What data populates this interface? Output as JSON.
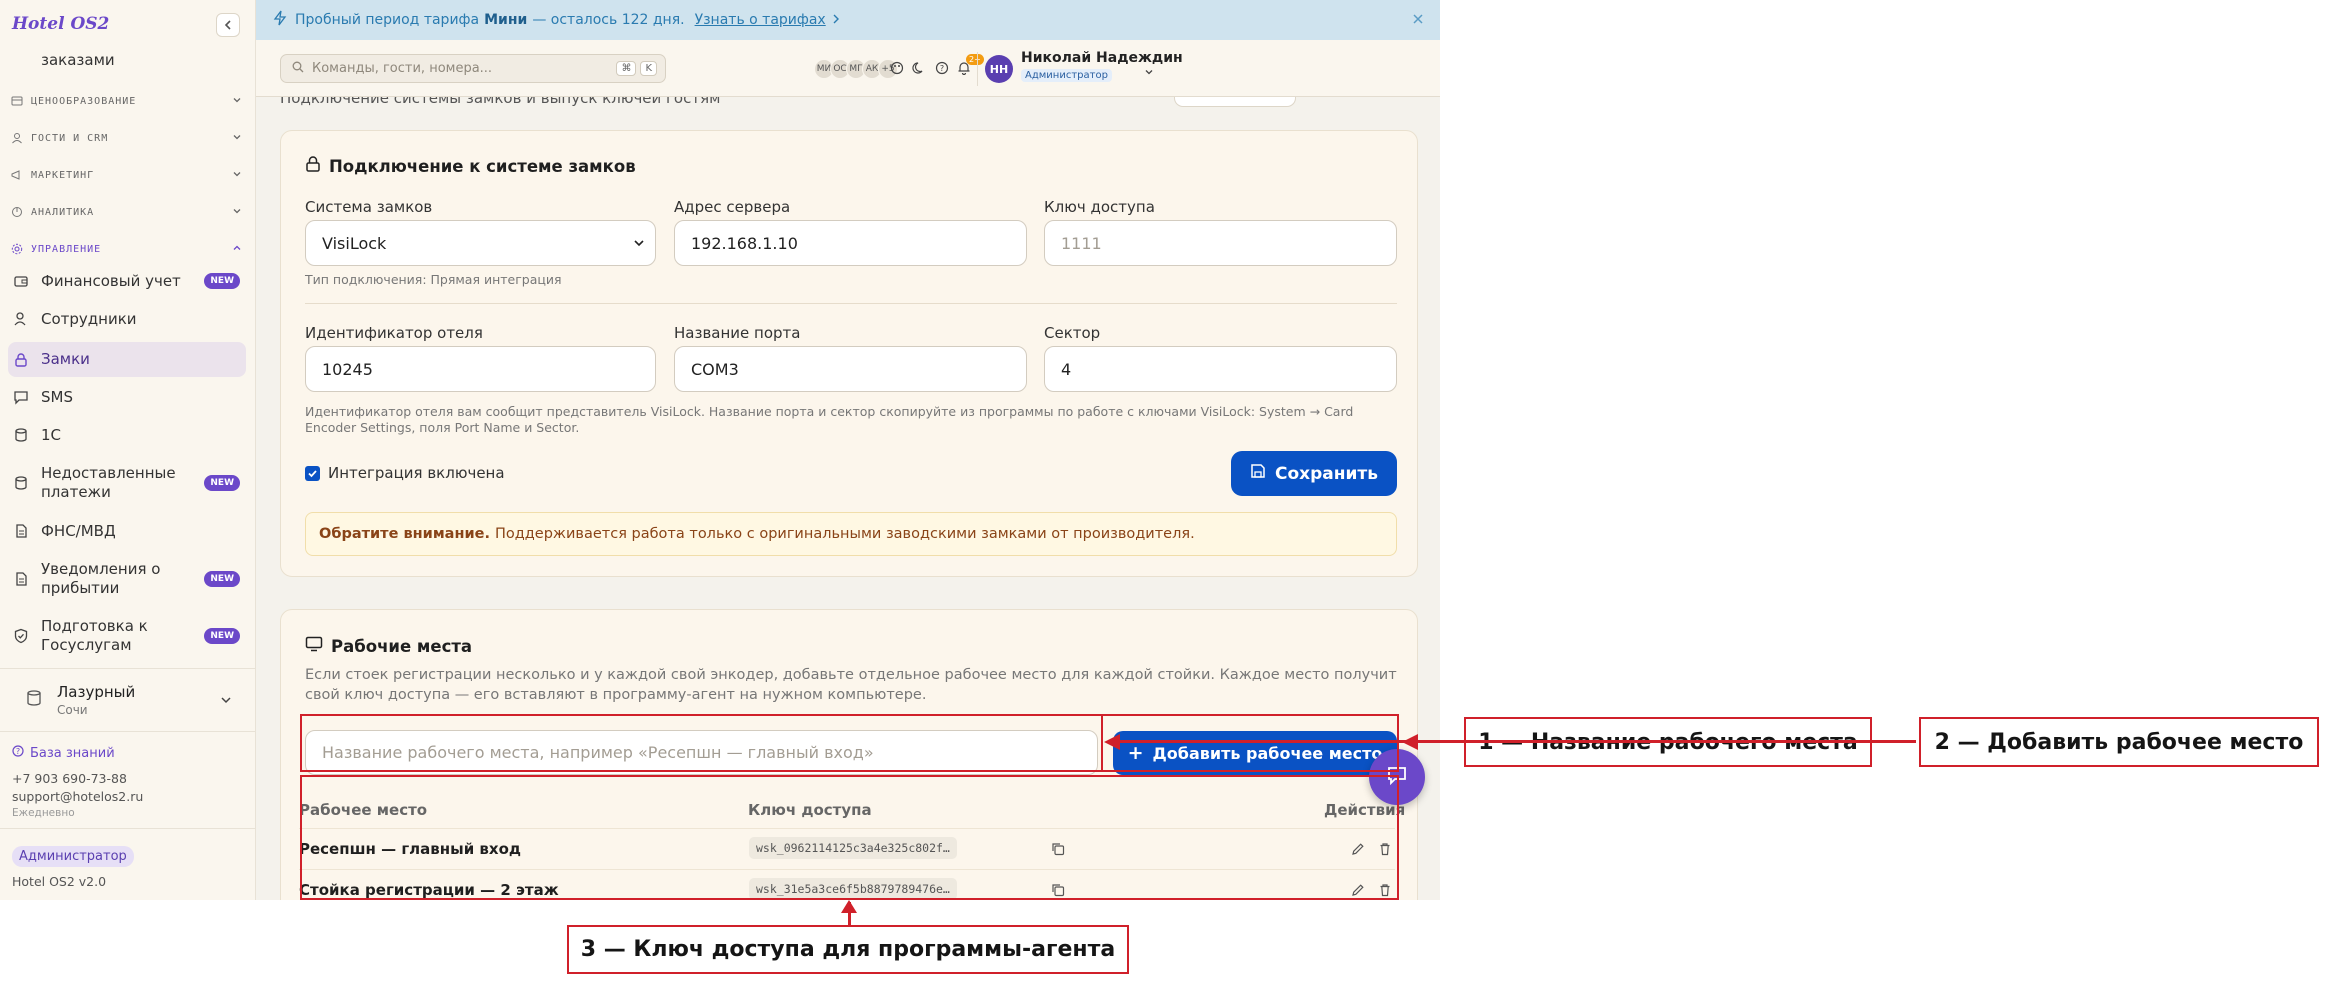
{
  "app": {
    "brand": "Hotel OS2"
  },
  "banner": {
    "text_prefix": "Пробный период тарифа",
    "plan": "Мини",
    "text_suffix": "— осталось 122 дня.",
    "link": "Узнать о тарифах"
  },
  "header": {
    "search_placeholder": "Команды, гости, номера...",
    "kbd1": "⌘",
    "kbd2": "K",
    "avatars": [
      "МИ",
      "ОС",
      "МГ",
      "АК"
    ],
    "avatars_more": "+5",
    "notif_count": "2+",
    "user_initials": "НН",
    "user_name": "Николай Надеждин",
    "user_role": "Администратор"
  },
  "sidebar": {
    "top_item": "заказами",
    "sections": [
      {
        "label": "ЦЕНООБРАЗОВАНИЕ",
        "icon": "price-tag-icon"
      },
      {
        "label": "ГОСТИ И CRM",
        "icon": "users-icon"
      },
      {
        "label": "МАРКЕТИНГ",
        "icon": "megaphone-icon"
      },
      {
        "label": "АНАЛИТИКА",
        "icon": "chart-icon"
      },
      {
        "label": "УПРАВЛЕНИЕ",
        "icon": "gear-icon"
      }
    ],
    "items": [
      {
        "label": "Финансовый учет",
        "badge": "NEW"
      },
      {
        "label": "Сотрудники",
        "badge": ""
      },
      {
        "label": "Замки",
        "badge": ""
      },
      {
        "label": "SMS",
        "badge": ""
      },
      {
        "label": "1С",
        "badge": ""
      },
      {
        "label": "Недоставленные платежи",
        "badge": "NEW"
      },
      {
        "label": "ФНС/МВД",
        "badge": ""
      },
      {
        "label": "Уведомления о прибытии",
        "badge": "NEW"
      },
      {
        "label": "Подготовка к Госуслугам",
        "badge": "NEW"
      }
    ],
    "hotel_name": "Лазурный",
    "hotel_city": "Сочи",
    "kb_link": "База знаний",
    "phone": "+7 903 690-73-88",
    "email": "support@hotelos2.ru",
    "schedule": "Ежедневно",
    "role_badge": "Администратор",
    "version": "Hotel OS2 v2.0"
  },
  "page": {
    "subtitle": "Подключение системы замков и выпуск ключей гостям"
  },
  "lock_card": {
    "title": "Подключение к системе замков",
    "system_label": "Система замков",
    "system_value": "VisiLock",
    "connection_type": "Тип подключения: Прямая интеграция",
    "server_label": "Адрес сервера",
    "server_value": "192.168.1.10",
    "key_label": "Ключ доступа",
    "key_placeholder": "1111",
    "hotel_id_label": "Идентификатор отеля",
    "hotel_id_value": "10245",
    "port_label": "Название порта",
    "port_value": "COM3",
    "sector_label": "Сектор",
    "sector_value": "4",
    "help_text": "Идентификатор отеля вам сообщит представитель VisiLock. Название порта и сектор скопируйте из программы по работе с ключами VisiLock: System → Card Encoder Settings, поля Port Name и Sector.",
    "integration_label": "Интеграция включена",
    "integration_checked": true,
    "save_label": "Сохранить",
    "notice_bold": "Обратите внимание.",
    "notice_text": "Поддерживается работа только с оригинальными заводскими замками от производителя."
  },
  "workplaces": {
    "title": "Рабочие места",
    "description": "Если стоек регистрации несколько и у каждой свой энкодер, добавьте отдельное рабочее место для каждой стойки. Каждое место получит свой ключ доступа — его вставляют в программу-агент на нужном компьютере.",
    "input_placeholder": "Название рабочего места, например «Ресепшн — главный вход»",
    "add_label": "Добавить рабочее место",
    "col_place": "Рабочее место",
    "col_key": "Ключ доступа",
    "col_actions": "Действия",
    "rows": [
      {
        "name": "Ресепшн — главный вход",
        "key": "wsk_0962114125c3a4e325c802f…"
      },
      {
        "name": "Стойка регистрации — 2 этаж",
        "key": "wsk_31e5a3ce6f5b8879789476e…"
      }
    ]
  },
  "annotations": {
    "a1": "1 — Название рабочего места",
    "a2": "2 — Добавить рабочее место",
    "a3": "3 — Ключ доступа для программы-агента"
  },
  "colors": {
    "accent": "#6b48c9",
    "primary_button": "#0a52c4",
    "annotation": "#d0202a",
    "banner_bg": "#cfe3ee"
  }
}
